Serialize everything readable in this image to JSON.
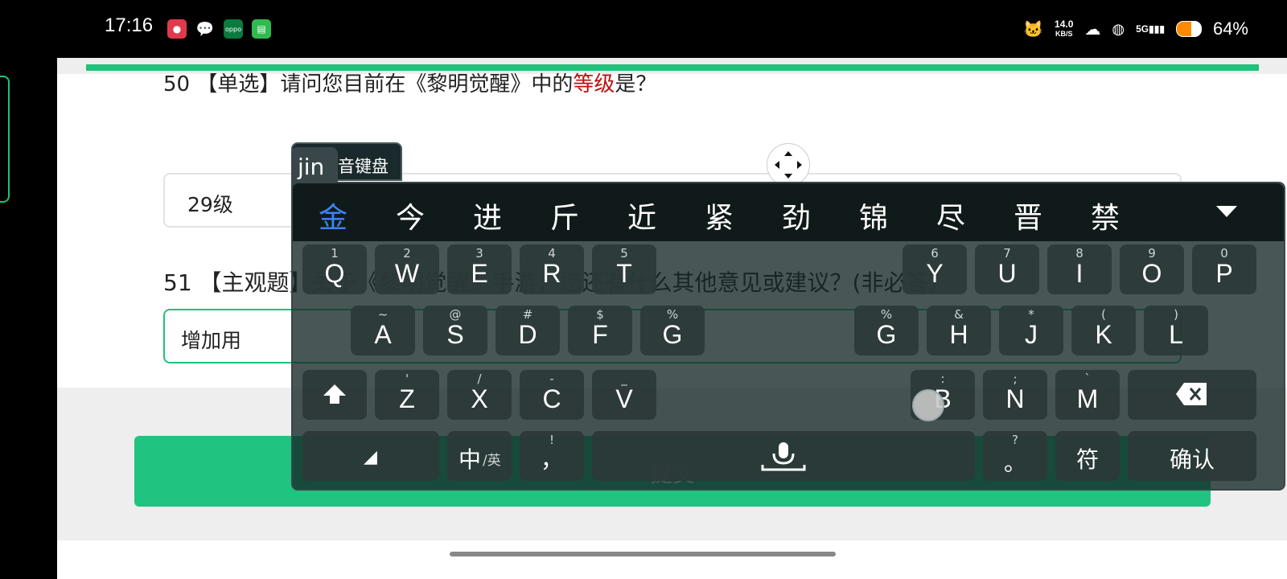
{
  "status_bar": {
    "time": "17:16",
    "net_speed_value": "14.0",
    "net_speed_unit": "KB/S",
    "network_type": "5G",
    "battery": "64%",
    "app_icons": [
      {
        "name": "screen-recorder-icon",
        "color": "#e03a4b"
      },
      {
        "name": "wechat-icon",
        "color": "#000000"
      },
      {
        "name": "oppo-icon",
        "color": "#0a7a3e"
      },
      {
        "name": "store-icon",
        "color": "#2fbb4f"
      }
    ]
  },
  "survey": {
    "q50": {
      "prefix": "50 【单选】请问您目前在《黎明觉醒》中的",
      "emphasis": "等级",
      "suffix": "是？"
    },
    "q50_answer": "29级",
    "q51": {
      "text": "51 【主观题】关于《黎明觉醒》手游，您还有什么其他意见或建议？(非必答)"
    },
    "q51_input_value": "增加用",
    "submit_label": "提交",
    "accent_color": "#21c381"
  },
  "keyboard": {
    "tab_label": "音键盘",
    "pinyin": "jin",
    "candidates": [
      "金",
      "今",
      "进",
      "斤",
      "近",
      "紧",
      "劲",
      "锦",
      "尽",
      "晋",
      "禁"
    ],
    "row1": [
      {
        "k": "Q",
        "s": "1"
      },
      {
        "k": "W",
        "s": "2"
      },
      {
        "k": "E",
        "s": "3"
      },
      {
        "k": "R",
        "s": "4"
      },
      {
        "k": "T",
        "s": "5"
      },
      {
        "k": "Y",
        "s": "6"
      },
      {
        "k": "U",
        "s": "7"
      },
      {
        "k": "I",
        "s": "8"
      },
      {
        "k": "O",
        "s": "9"
      },
      {
        "k": "P",
        "s": "0"
      }
    ],
    "row2": [
      {
        "k": "A",
        "s": "~"
      },
      {
        "k": "S",
        "s": "@"
      },
      {
        "k": "D",
        "s": "#"
      },
      {
        "k": "F",
        "s": "$"
      },
      {
        "k": "G",
        "s": "%"
      },
      {
        "k": "G",
        "s": "%"
      },
      {
        "k": "H",
        "s": "&"
      },
      {
        "k": "J",
        "s": "*"
      },
      {
        "k": "K",
        "s": "("
      },
      {
        "k": "L",
        "s": ")"
      }
    ],
    "row3": [
      {
        "k": "Z",
        "s": "'"
      },
      {
        "k": "X",
        "s": "/"
      },
      {
        "k": "C",
        "s": "-"
      },
      {
        "k": "V",
        "s": "_"
      },
      {
        "k": "B",
        "s": ":"
      },
      {
        "k": "N",
        "s": ";"
      },
      {
        "k": "M",
        "s": "`"
      }
    ],
    "comma_sub": "!",
    "comma": "，",
    "period_sub": "?",
    "period": "。",
    "lang_main": "中",
    "lang_alt": "/英",
    "symbols": "符",
    "confirm": "确认"
  }
}
